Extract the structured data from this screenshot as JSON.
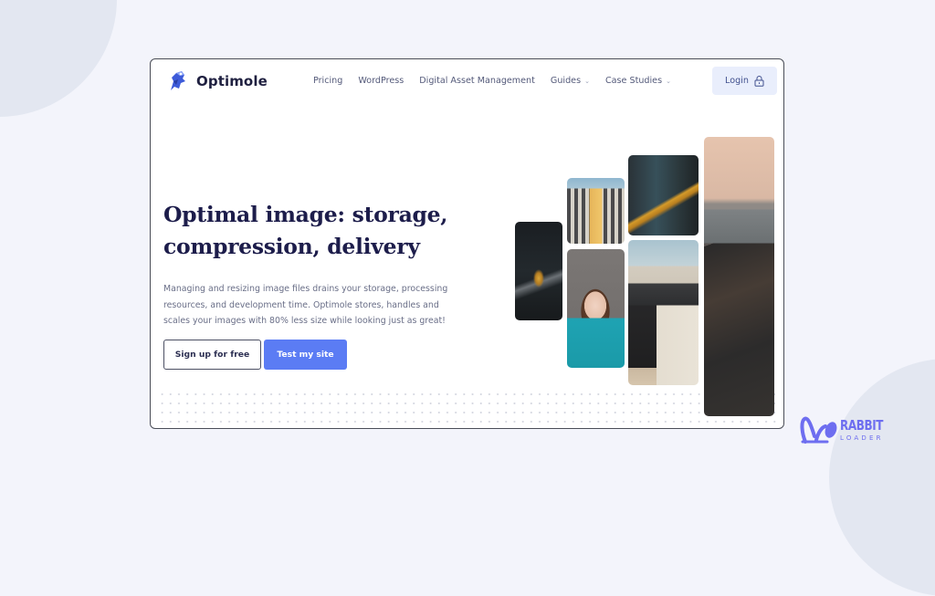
{
  "site": {
    "brand": "Optimole",
    "logo_icon": "optimole-mascot-icon"
  },
  "nav": {
    "items": [
      {
        "label": "Pricing",
        "has_dropdown": false
      },
      {
        "label": "WordPress",
        "has_dropdown": false
      },
      {
        "label": "Digital Asset Management",
        "has_dropdown": false
      },
      {
        "label": "Guides",
        "has_dropdown": true
      },
      {
        "label": "Case Studies",
        "has_dropdown": true
      }
    ],
    "caret": "⌄",
    "login_label": "Login",
    "login_icon": "lock-icon"
  },
  "hero": {
    "title_line1": "Optimal image: storage,",
    "title_line2": "compression, delivery",
    "description": "Managing and resizing image files drains your storage, processing resources, and development time. Optimole stores, handles and scales your images with 80% less size while looking just as great!",
    "signup_label": "Sign up for free",
    "test_label": "Test my site"
  },
  "gallery": {
    "photos": [
      {
        "name": "hiker-in-cave"
      },
      {
        "name": "building-facade"
      },
      {
        "name": "woman-with-book"
      },
      {
        "name": "subway-train"
      },
      {
        "name": "concrete-bridge"
      },
      {
        "name": "coastline-aerial"
      }
    ]
  },
  "watermark": {
    "line1": "RABBIT",
    "line2": "LOADER",
    "icon": "rabbit-ears-icon"
  },
  "colors": {
    "accent": "#5b7cf4",
    "title": "#1d1d4b",
    "login_bg": "#e9eefc",
    "watermark": "#6e6ef0",
    "page_bg": "#f3f4fb"
  }
}
